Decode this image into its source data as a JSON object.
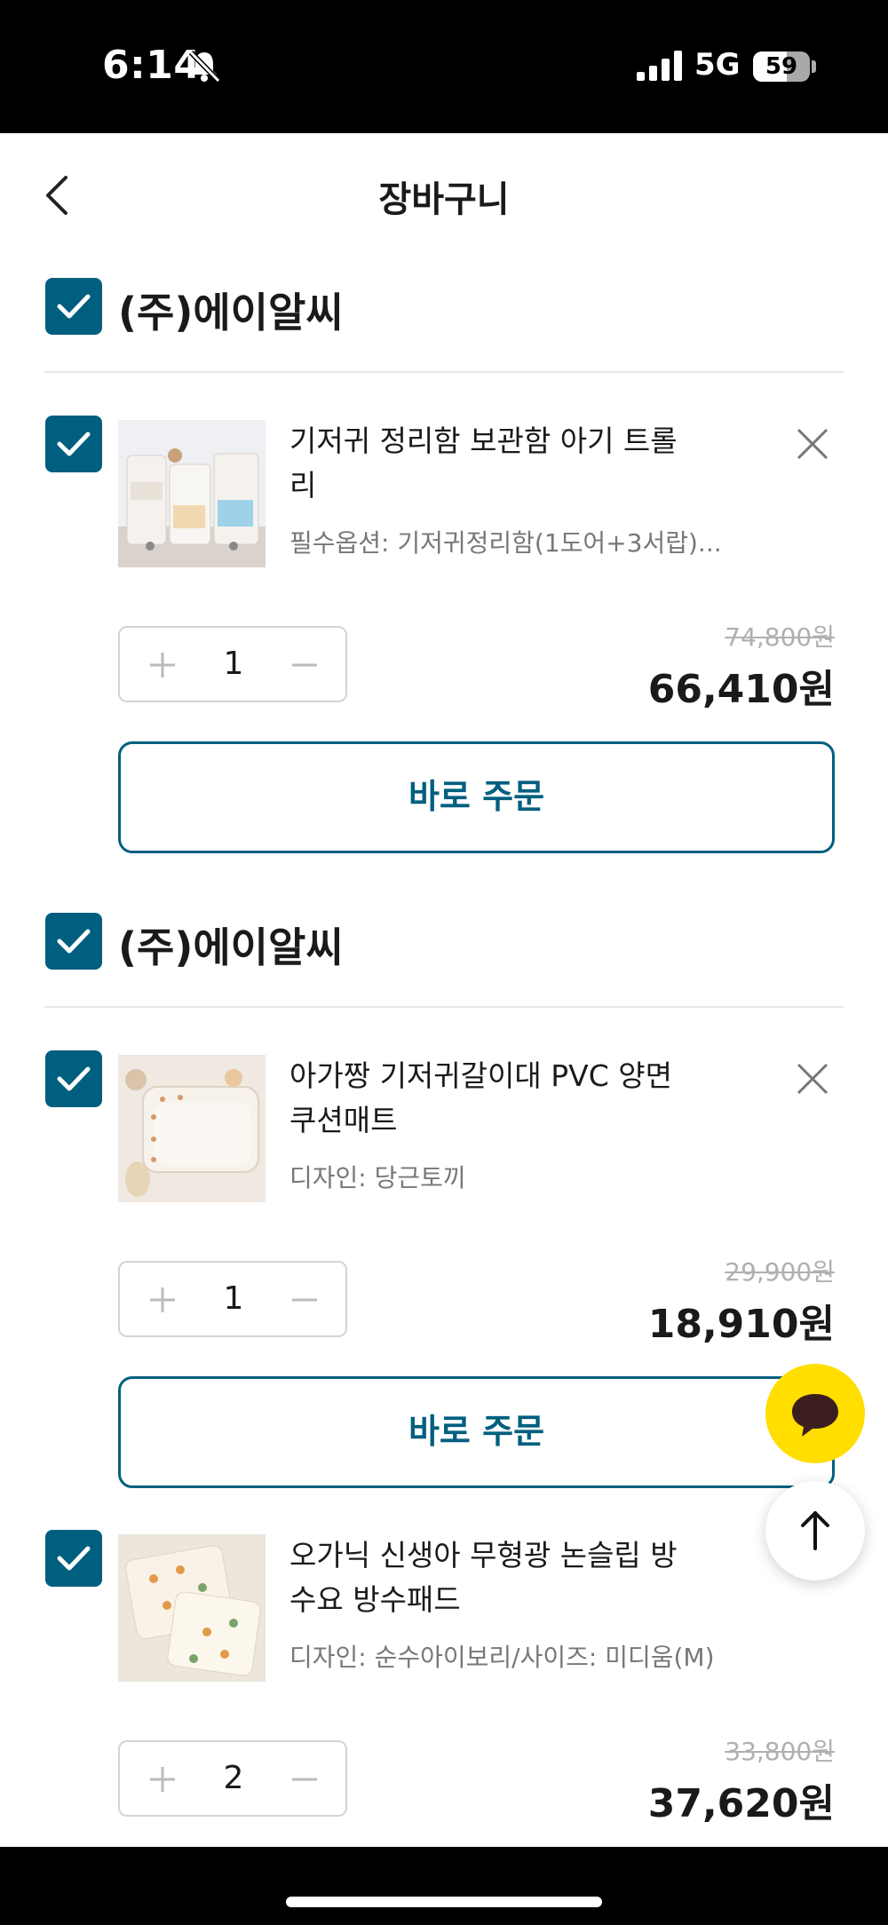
{
  "status_bar": {
    "time": "6:14",
    "network": "5G",
    "battery_level": "59",
    "battery_fraction": 0.59
  },
  "header": {
    "title": "장바구니"
  },
  "cart": [
    {
      "seller": "(주)에이알씨",
      "checked": true,
      "items": [
        {
          "checked": true,
          "title": "기저귀 정리함 보관함 아기 트롤리",
          "option": "필수옵션: 기저귀정리함(1도어+3서랍)...",
          "quantity": "1",
          "original_price": "74,800원",
          "sale_price": "66,410원",
          "order_label": "바로 주문"
        }
      ]
    },
    {
      "seller": "(주)에이알씨",
      "checked": true,
      "items": [
        {
          "checked": true,
          "title": "아가짱 기저귀갈이대 PVC 양면 쿠션매트",
          "option": "디자인: 당근토끼",
          "quantity": "1",
          "original_price": "29,900원",
          "sale_price": "18,910원",
          "order_label": "바로 주문"
        },
        {
          "checked": true,
          "title": "오가닉 신생아 무형광 논슬립 방수요 방수패드",
          "option": "디자인: 순수아이보리/사이즈: 미디움(M)",
          "quantity": "2",
          "original_price": "33,800원",
          "sale_price": "37,620원"
        }
      ]
    }
  ],
  "icons": {
    "chat": "chat-bubble-icon",
    "scroll_top": "arrow-up-icon",
    "remove": "close-icon",
    "back": "chevron-left-icon"
  },
  "colors": {
    "accent": "#005f7f",
    "chat_button": "#ffde00"
  }
}
